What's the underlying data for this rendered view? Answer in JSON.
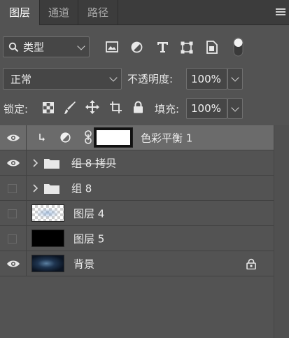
{
  "tabs": [
    {
      "label": "图层",
      "active": true
    },
    {
      "label": "通道",
      "active": false
    },
    {
      "label": "路径",
      "active": false
    }
  ],
  "filter": {
    "kind_label": "类型"
  },
  "blend": {
    "mode": "正常",
    "opacity_label": "不透明度:",
    "opacity_value": "100%"
  },
  "lock": {
    "label": "锁定:",
    "fill_label": "填充:",
    "fill_value": "100%"
  },
  "layers": [
    {
      "name": "色彩平衡 1",
      "visible": true,
      "selected": true,
      "type": "adjustment"
    },
    {
      "name": "组 8 拷贝",
      "visible": true,
      "selected": false,
      "type": "group",
      "strikethrough": true
    },
    {
      "name": "组 8",
      "visible": false,
      "selected": false,
      "type": "group"
    },
    {
      "name": "图层 4",
      "visible": false,
      "selected": false,
      "type": "transparent"
    },
    {
      "name": "图层 5",
      "visible": false,
      "selected": false,
      "type": "black"
    },
    {
      "name": "背景",
      "visible": true,
      "selected": false,
      "type": "background",
      "locked": true
    }
  ],
  "colors": {
    "panel": "#535353",
    "tabbar": "#3c3c3c",
    "selected_row": "#6b6b6b"
  }
}
